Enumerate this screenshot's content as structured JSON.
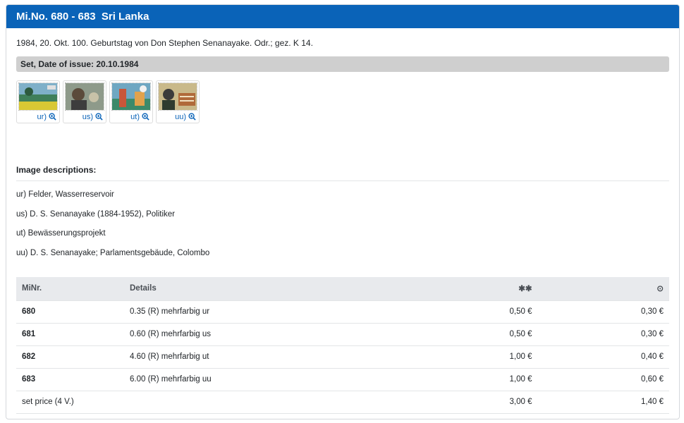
{
  "header": {
    "title": "Mi.No. 680 - 683  Sri Lanka"
  },
  "subtitle": "1984, 20. Okt. 100. Geburtstag von Don Stephen Senanayake. Odr.; gez. K 14.",
  "set_bar": "Set, Date of issue: 20.10.1984",
  "thumbnails": [
    {
      "label": "ur)"
    },
    {
      "label": "us)"
    },
    {
      "label": "ut)"
    },
    {
      "label": "uu)"
    }
  ],
  "image_descriptions": {
    "title": "Image descriptions:",
    "items": [
      "ur) Felder, Wasserreservoir",
      "us) D. S. Senanayake (1884-1952), Politiker",
      "ut) Bewässerungsprojekt",
      "uu) D. S. Senanayake; Parlamentsgebäude, Colombo"
    ]
  },
  "table": {
    "headers": {
      "nr": "MiNr.",
      "details": "Details",
      "mint": "✱✱",
      "used": "⊙"
    },
    "rows": [
      {
        "nr": "680",
        "details": "0.35 (R) mehrfarbig ur",
        "mint": "0,50 €",
        "used": "0,30 €"
      },
      {
        "nr": "681",
        "details": "0.60 (R) mehrfarbig us",
        "mint": "0,50 €",
        "used": "0,30 €"
      },
      {
        "nr": "682",
        "details": "4.60 (R) mehrfarbig ut",
        "mint": "1,00 €",
        "used": "0,40 €"
      },
      {
        "nr": "683",
        "details": "6.00 (R) mehrfarbig uu",
        "mint": "1,00 €",
        "used": "0,60 €"
      }
    ],
    "set_price": {
      "label": "set price (4 V.)",
      "mint": "3,00 €",
      "used": "1,40 €"
    }
  },
  "colors": {
    "header_bg": "#0a63b8",
    "link": "#0a63b8",
    "set_bar_bg": "#cfcfcf",
    "table_head_bg": "#e8eaed"
  },
  "icons": {
    "zoom": "zoom-in-icon"
  }
}
